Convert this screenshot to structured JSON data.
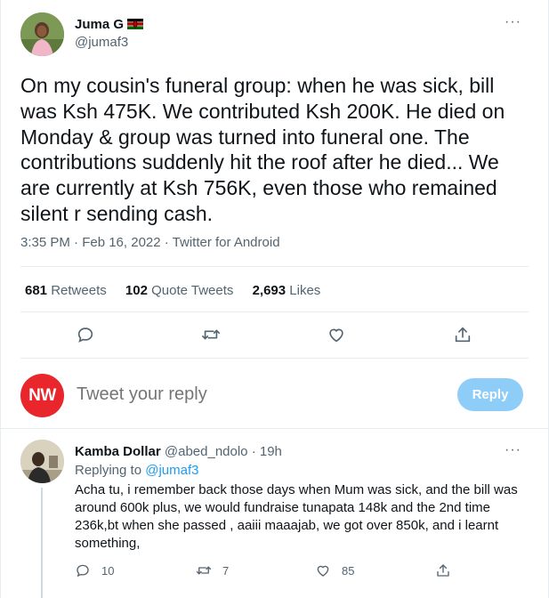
{
  "tweet": {
    "author": {
      "name": "Juma G",
      "handle": "@jumaf3"
    },
    "more_label": "···",
    "text": "On my cousin's funeral group: when he was sick, bill was Ksh 475K. We contributed Ksh 200K. He died on Monday & group was turned into funeral one. The contributions suddenly hit the roof after he died... We are currently at Ksh 756K, even those who remained silent r sending cash.",
    "meta": "3:35 PM · Feb 16, 2022 · Twitter for Android",
    "stats": {
      "retweets_count": "681",
      "retweets_label": "Retweets",
      "quotes_count": "102",
      "quotes_label": "Quote Tweets",
      "likes_count": "2,693",
      "likes_label": "Likes"
    },
    "actions": [
      "reply-icon",
      "retweet-icon",
      "like-icon",
      "share-icon"
    ]
  },
  "composer": {
    "avatar_text": "NW",
    "placeholder": "Tweet your reply",
    "button_label": "Reply"
  },
  "reply": {
    "name": "Kamba Dollar",
    "handle": "@abed_ndolo",
    "time": "· 19h",
    "more_label": "···",
    "replying_prefix": "Replying to ",
    "replying_to": "@jumaf3",
    "text": "Acha tu, i remember back those days when Mum was sick, and the bill was around 600k plus, we would fundraise tunapata 148k and the 2nd time 236k,bt when she passed , aaiii maaajab, we got over 850k, and i learnt something,",
    "reply_count": "10",
    "retweet_count": "7",
    "like_count": "85"
  },
  "colors": {
    "accent": "#1d9bf0",
    "reply_button": "#8ecdf8",
    "nw_badge": "#e8262c",
    "muted_text": "#536471",
    "divider": "#e6ecf0"
  }
}
